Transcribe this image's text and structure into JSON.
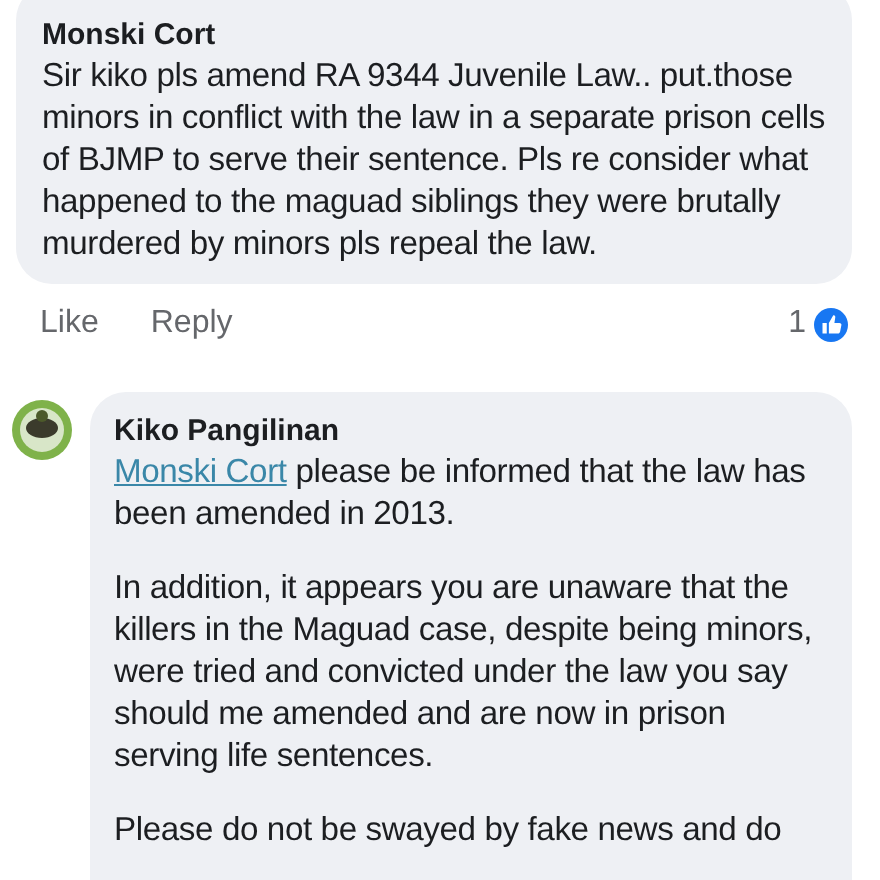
{
  "comment": {
    "author": "Monski Cort",
    "text": "Sir kiko pls amend RA 9344 Juvenile Law.. put.those minors in conflict with the law in a separate prison cells of BJMP to serve their sentence. Pls re consider what happened to the maguad siblings they were brutally murdered by minors pls repeal the law.",
    "actions": [
      "Like",
      "Reply"
    ],
    "reaction_count": "1"
  },
  "reply": {
    "author": "Kiko Pangilinan",
    "paragraphs": [
      {
        "mention": "Monski Cort",
        "text": "please be informed that the law has been amended in 2013."
      },
      {
        "text": "In addition, it appears you are unaware that the killers in the Maguad case, despite being minors, were tried and convicted under the law you say should me amended and are now in prison serving life sentences."
      },
      {
        "text": "Please do not be swayed by fake news and do"
      }
    ]
  }
}
